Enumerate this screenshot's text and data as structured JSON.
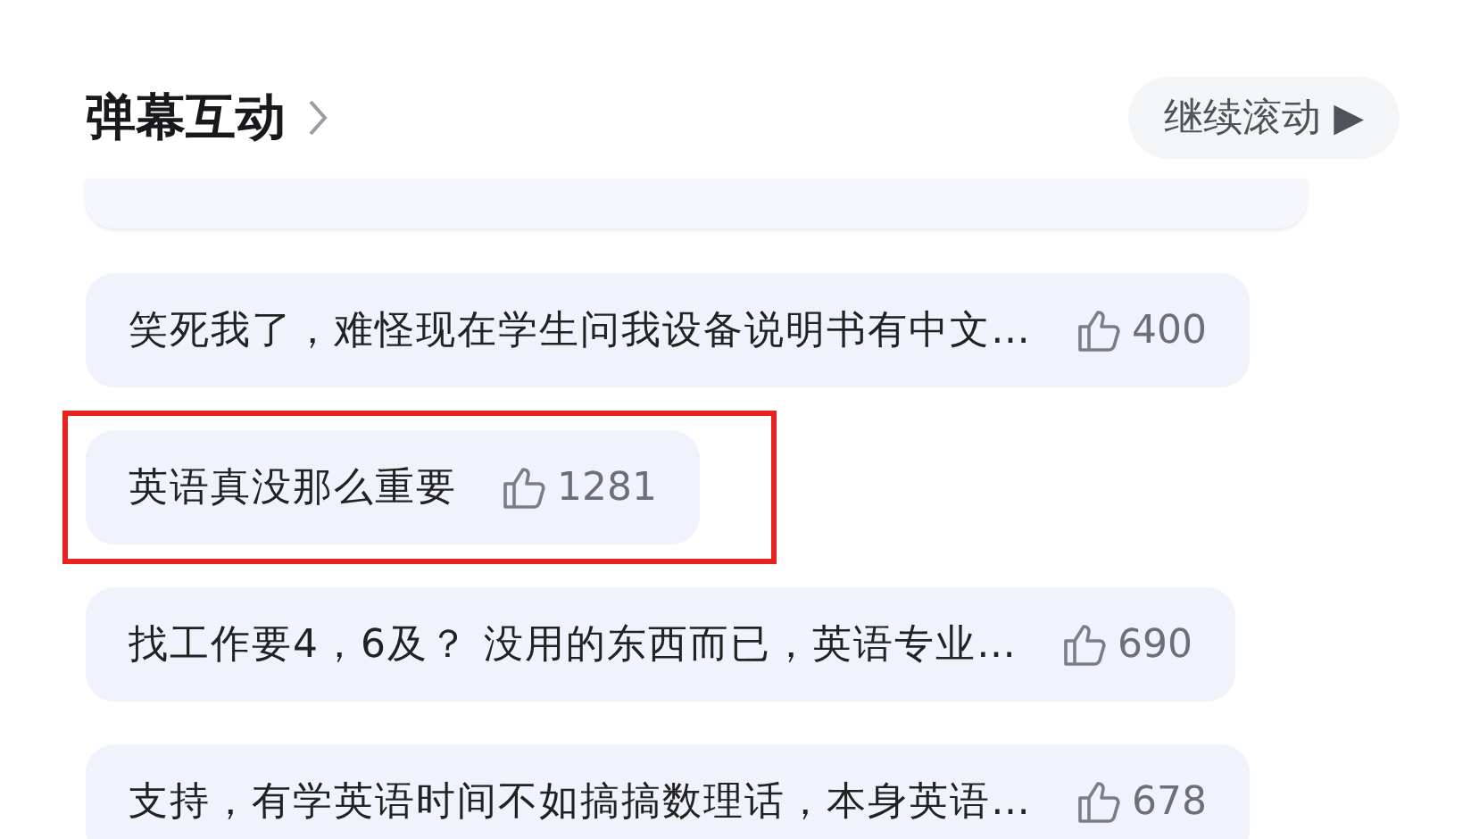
{
  "header": {
    "title": "弹幕互动",
    "button": "继续滚动 ▶"
  },
  "comments": [
    {
      "text": "笑死我了，难怪现在学生问我设备说明书有中文…",
      "likes": "400",
      "highlighted": false
    },
    {
      "text": "英语真没那么重要",
      "likes": "1281",
      "highlighted": true
    },
    {
      "text": "找工作要4，6及？ 没用的东西而已，英语专业…",
      "likes": "690",
      "highlighted": false
    },
    {
      "text": "支持，有学英语时间不如搞搞数理话，本身英语…",
      "likes": "678",
      "highlighted": false
    }
  ]
}
